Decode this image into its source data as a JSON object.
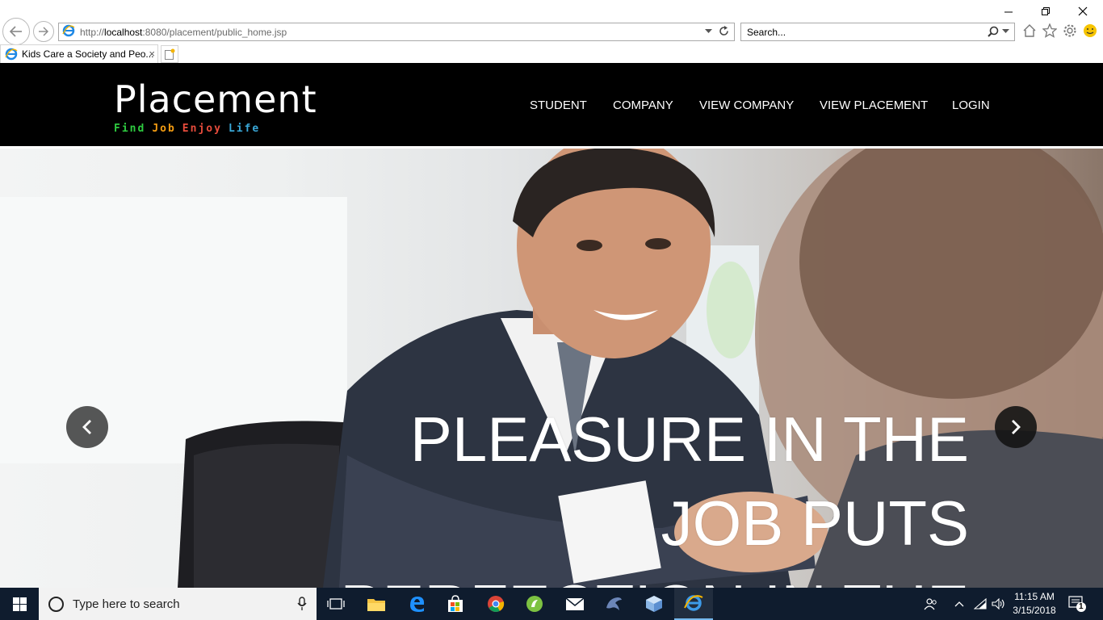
{
  "browser": {
    "url_prefix": "http://",
    "url_host": "localhost",
    "url_path": ":8080/placement/public_home.jsp",
    "search_placeholder": "Search...",
    "tab_title": "Kids Care a Society and Peo...",
    "tab_close": "×"
  },
  "site": {
    "logo": "Placement",
    "tagline": [
      {
        "word": "Find",
        "color": "#2ecc40"
      },
      {
        "word": "Job",
        "color": "#f39c12"
      },
      {
        "word": "Enjoy",
        "color": "#e74c3c"
      },
      {
        "word": "Life",
        "color": "#3aa8d8"
      }
    ],
    "menu": [
      "STUDENT",
      "COMPANY",
      "VIEW COMPANY",
      "VIEW PLACEMENT",
      "LOGIN"
    ],
    "hero_caption": [
      "PLEASURE IN THE",
      "JOB PUTS",
      "PERFECTION IN THE"
    ]
  },
  "taskbar": {
    "search_placeholder": "Type here to search",
    "time": "11:15 AM",
    "date": "3/15/2018",
    "notification_count": "1"
  }
}
